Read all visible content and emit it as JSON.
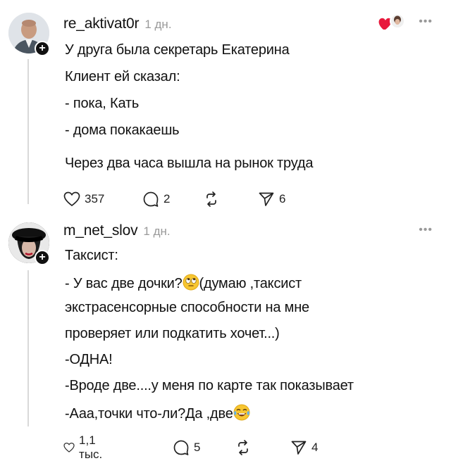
{
  "posts": [
    {
      "username": "re_aktivat0r",
      "time": "1 дн.",
      "lines": [
        "У друга была секретарь Екатерина",
        "Клиент ей сказал:",
        "- пока, Кать",
        "- дома покакаешь",
        "Через два часа вышла на рынок труда"
      ],
      "likes": "357",
      "comments": "2",
      "shares": "6"
    },
    {
      "username": "m_net_slov",
      "time": "1 дн.",
      "lines": [
        "Таксист:",
        "- У вас две дочки?",
        "(думаю ,таксист",
        "экстрасенсорные способности на мне",
        "проверяет или подкатить хочет...)",
        "-ОДНА!",
        "-Вроде две....у меня по карте так показывает",
        "-Ааа,точки что-ли?Да ,две"
      ],
      "likes": "1,1 тыс.",
      "comments": "5",
      "shares": "4"
    }
  ],
  "more_label": "•••",
  "icons": {
    "like": "heart-icon",
    "comment": "comment-bubble-icon",
    "repost": "repost-icon",
    "share": "send-icon",
    "emoji_rolling_eyes": "rolling-eyes-emoji",
    "emoji_laughing": "laughing-tears-emoji"
  }
}
